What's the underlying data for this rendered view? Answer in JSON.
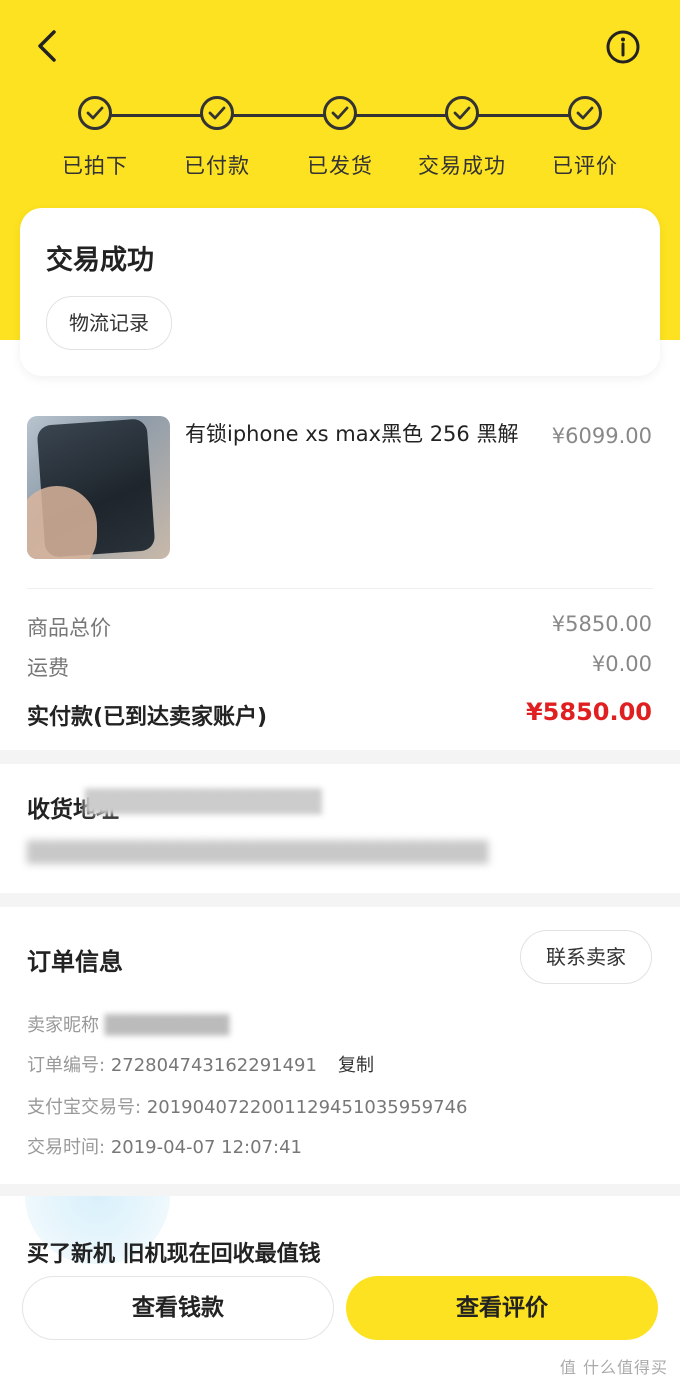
{
  "header": {
    "back_icon": "chevron-left-icon",
    "info_icon": "info-circle-icon"
  },
  "steps": [
    {
      "label": "已拍下",
      "done": true
    },
    {
      "label": "已付款",
      "done": true
    },
    {
      "label": "已发货",
      "done": true
    },
    {
      "label": "交易成功",
      "done": true
    },
    {
      "label": "已评价",
      "done": true
    }
  ],
  "status": {
    "title": "交易成功",
    "logistics_button": "物流记录"
  },
  "product": {
    "title": "有锁iphone xs max黑色 256 黑解",
    "price": "¥6099.00"
  },
  "summary": {
    "goods_total_label": "商品总价",
    "goods_total_value": "¥5850.00",
    "shipping_label": "运费",
    "shipping_value": "¥0.00",
    "paid_label": "实付款(已到达卖家账户)",
    "paid_value": "¥5850.00"
  },
  "address": {
    "title": "收货地址"
  },
  "order": {
    "title": "订单信息",
    "contact_button": "联系卖家",
    "seller_label": "卖家昵称",
    "order_no_label": "订单编号:",
    "order_no_value": "272804743162291491",
    "copy_label": "复制",
    "alipay_label": "支付宝交易号:",
    "alipay_value": "2019040722001129451035959746",
    "time_label": "交易时间:",
    "time_value": "2019-04-07 12:07:41"
  },
  "promo": {
    "text": "买了新机 旧机现在回收最值钱"
  },
  "bottom": {
    "money_button": "查看钱款",
    "review_button": "查看评价"
  },
  "watermark": "值 什么值得买",
  "colors": {
    "accent_yellow": "#fde221",
    "price_red": "#e02020"
  }
}
